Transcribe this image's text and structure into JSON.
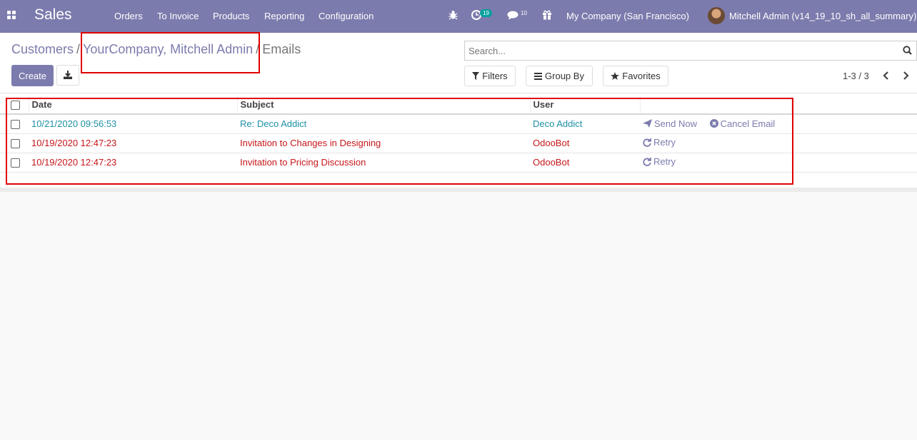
{
  "navbar": {
    "app_name": "Sales",
    "menu": [
      "Orders",
      "To Invoice",
      "Products",
      "Reporting",
      "Configuration"
    ],
    "activity_count": "19",
    "message_count": "10",
    "company": "My Company (San Francisco)",
    "user": "Mitchell Admin (v14_19_10_sh_all_summary)",
    "colors": {
      "primary": "#7c7bad",
      "activity_badge": "#00a09d"
    }
  },
  "breadcrumb": {
    "items": [
      "Customers",
      "YourCompany, Mitchell Admin"
    ],
    "separator": "/",
    "current": "Emails"
  },
  "buttons": {
    "create": "Create"
  },
  "search": {
    "placeholder": "Search..."
  },
  "filters": {
    "filters": "Filters",
    "group_by": "Group By",
    "favorites": "Favorites"
  },
  "pager": {
    "value": "1-3 / 3"
  },
  "table": {
    "columns": {
      "date": "Date",
      "subject": "Subject",
      "user": "User"
    },
    "rows": [
      {
        "status": "outgoing",
        "date": "10/21/2020 09:56:53",
        "subject": "Re: Deco Addict",
        "user": "Deco Addict",
        "actions": [
          "Send Now",
          "Cancel Email"
        ]
      },
      {
        "status": "exception",
        "date": "10/19/2020 12:47:23",
        "subject": "Invitation to Changes in Designing",
        "user": "OdooBot",
        "actions": [
          "Retry"
        ]
      },
      {
        "status": "exception",
        "date": "10/19/2020 12:47:23",
        "subject": "Invitation to Pricing Discussion",
        "user": "OdooBot",
        "actions": [
          "Retry"
        ]
      }
    ]
  }
}
